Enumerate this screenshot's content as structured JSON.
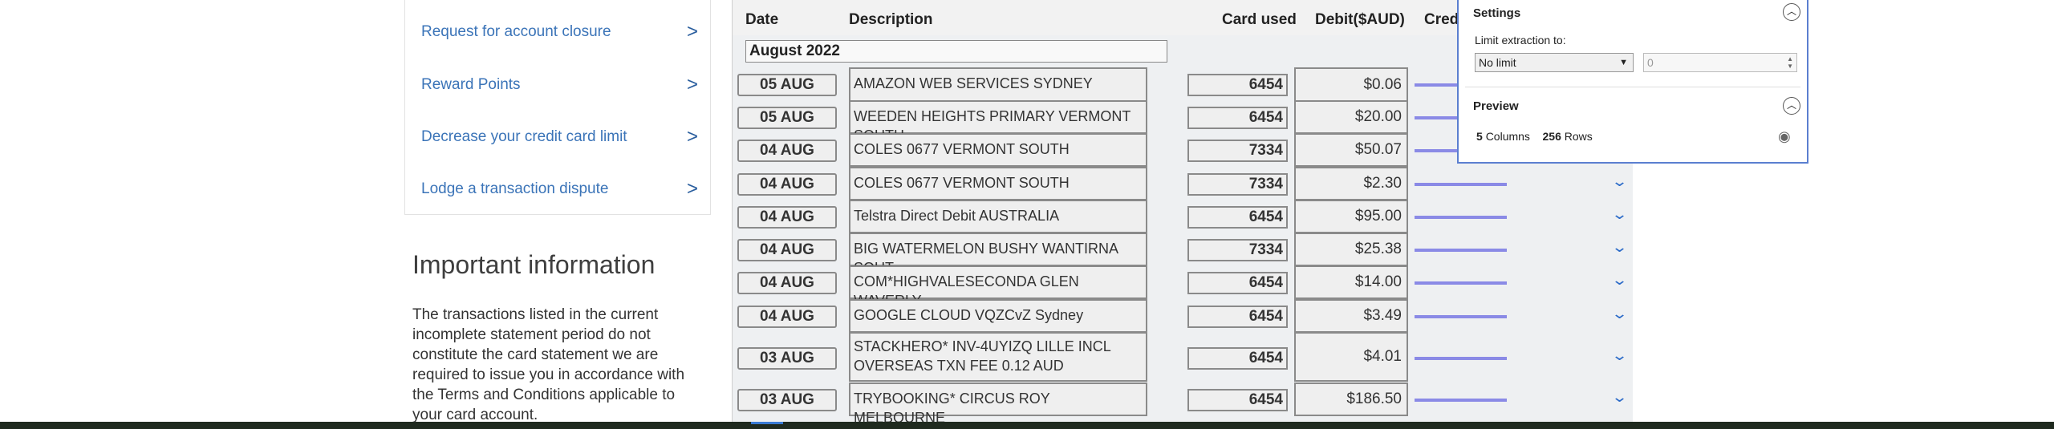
{
  "sidebar": {
    "links": [
      {
        "label": "Request for account closure"
      },
      {
        "label": "Reward Points"
      },
      {
        "label": "Decrease your credit card limit"
      },
      {
        "label": "Lodge a transaction dispute"
      }
    ],
    "chevron": ">"
  },
  "info": {
    "title": "Important information",
    "body": "The transactions listed in the current incomplete statement period do not constitute the card statement we are required to issue you in accordance with the Terms and Conditions applicable to your card account."
  },
  "table": {
    "headers": {
      "date": "Date",
      "description": "Description",
      "card": "Card used",
      "debit": "Debit($AUD)",
      "credit": "Cred"
    },
    "month": "August 2022",
    "rows": [
      {
        "date": "05 AUG",
        "description": "AMAZON WEB SERVICES SYDNEY",
        "card": "6454",
        "debit": "$0.06"
      },
      {
        "date": "05 AUG",
        "description": "WEEDEN HEIGHTS PRIMARY VERMONT SOUTH",
        "card": "6454",
        "debit": "$20.00"
      },
      {
        "date": "04 AUG",
        "description": "COLES 0677 VERMONT SOUTH",
        "card": "7334",
        "debit": "$50.07"
      },
      {
        "date": "04 AUG",
        "description": "COLES 0677 VERMONT SOUTH",
        "card": "7334",
        "debit": "$2.30"
      },
      {
        "date": "04 AUG",
        "description": "Telstra Direct Debit AUSTRALIA",
        "card": "6454",
        "debit": "$95.00"
      },
      {
        "date": "04 AUG",
        "description": "BIG WATERMELON BUSHY WANTIRNA SOUT",
        "card": "7334",
        "debit": "$25.38"
      },
      {
        "date": "04 AUG",
        "description": "COM*HIGHVALESECONDA GLEN WAVERLY",
        "card": "6454",
        "debit": "$14.00"
      },
      {
        "date": "04 AUG",
        "description": "GOOGLE CLOUD VQZCvZ Sydney",
        "card": "6454",
        "debit": "$3.49"
      },
      {
        "date": "03 AUG",
        "description": "STACKHERO* INV-4UYIZQ LILLE INCL OVERSEAS TXN FEE 0.12 AUD",
        "card": "6454",
        "debit": "$4.01"
      },
      {
        "date": "03 AUG",
        "description": "TRYBOOKING* CIRCUS ROY MELBOURNE",
        "card": "6454",
        "debit": "$186.50"
      }
    ]
  },
  "settings": {
    "title": "Settings",
    "limit_label": "Limit extraction to:",
    "limit_value": "No limit",
    "limit_number": "0",
    "preview_title": "Preview",
    "columns_count": "5",
    "columns_label": "Columns",
    "rows_count": "256",
    "rows_label": "Rows"
  },
  "icons": {
    "expand": "chevron-down-icon",
    "collapse": "chevron-up-icon",
    "preview": "eye-icon"
  },
  "colors": {
    "link": "#3b74b8",
    "panel_border": "#5b7fd0",
    "credit_bar": "#8a8ae6",
    "chevron": "#2a6ac8"
  }
}
